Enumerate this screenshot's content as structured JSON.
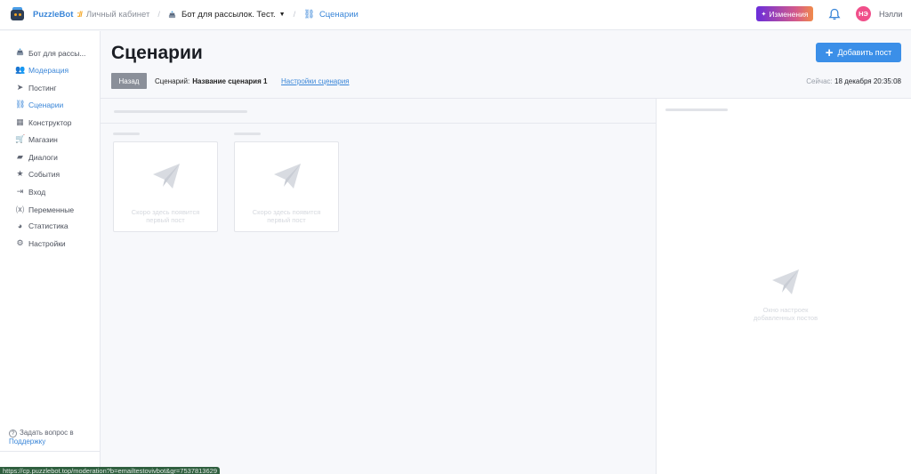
{
  "topbar": {
    "brand": "PuzzleBot",
    "brand_sep": "://",
    "cabinet": "Личный кабинет",
    "bot_name": "Бот для рассылок. Тест.",
    "section": "Сценарии",
    "changes_label": "Изменения",
    "avatar_initials": "НЭ",
    "username": "Нэлли"
  },
  "sidebar": {
    "items": [
      {
        "label": "Бот для рассы...",
        "icon": "cake-icon"
      },
      {
        "label": "Модерация",
        "icon": "users-icon"
      },
      {
        "label": "Постинг",
        "icon": "send-icon"
      },
      {
        "label": "Сценарии",
        "icon": "scenarios-icon"
      },
      {
        "label": "Конструктор",
        "icon": "grid-icon"
      },
      {
        "label": "Магазин",
        "icon": "cart-icon"
      },
      {
        "label": "Диалоги",
        "icon": "chat-icon"
      },
      {
        "label": "События",
        "icon": "star-icon"
      },
      {
        "label": "Вход",
        "icon": "login-icon"
      },
      {
        "label": "Переменные",
        "icon": "variables-icon"
      },
      {
        "label": "Статистика",
        "icon": "pie-icon"
      },
      {
        "label": "Настройки",
        "icon": "gear-icon"
      }
    ],
    "help_text": "Задать вопрос в",
    "help_link": "Поддержку"
  },
  "header": {
    "title": "Сценарии",
    "add_post_label": "Добавить пост",
    "back_label": "Назад",
    "scenario_label": "Сценарий:",
    "scenario_name": "Название сценария 1",
    "scenario_settings": "Настройки сценария",
    "now_label": "Сейчас:",
    "now_value": "18 декабря 20:35:08"
  },
  "cards": [
    {
      "placeholder": "Скоро здесь появится первый пост"
    },
    {
      "placeholder": "Скоро здесь появится первый пост"
    }
  ],
  "right_panel": {
    "placeholder": "Окно настроек добавленных постов"
  },
  "statusbar": {
    "url": "https://cp.puzzlebot.top/moderation?b=emailtestovivbot&gr=7537813629"
  },
  "colors": {
    "accent": "#3a86d8",
    "button_primary": "#3b8fe8",
    "avatar": "#f04f8a"
  }
}
